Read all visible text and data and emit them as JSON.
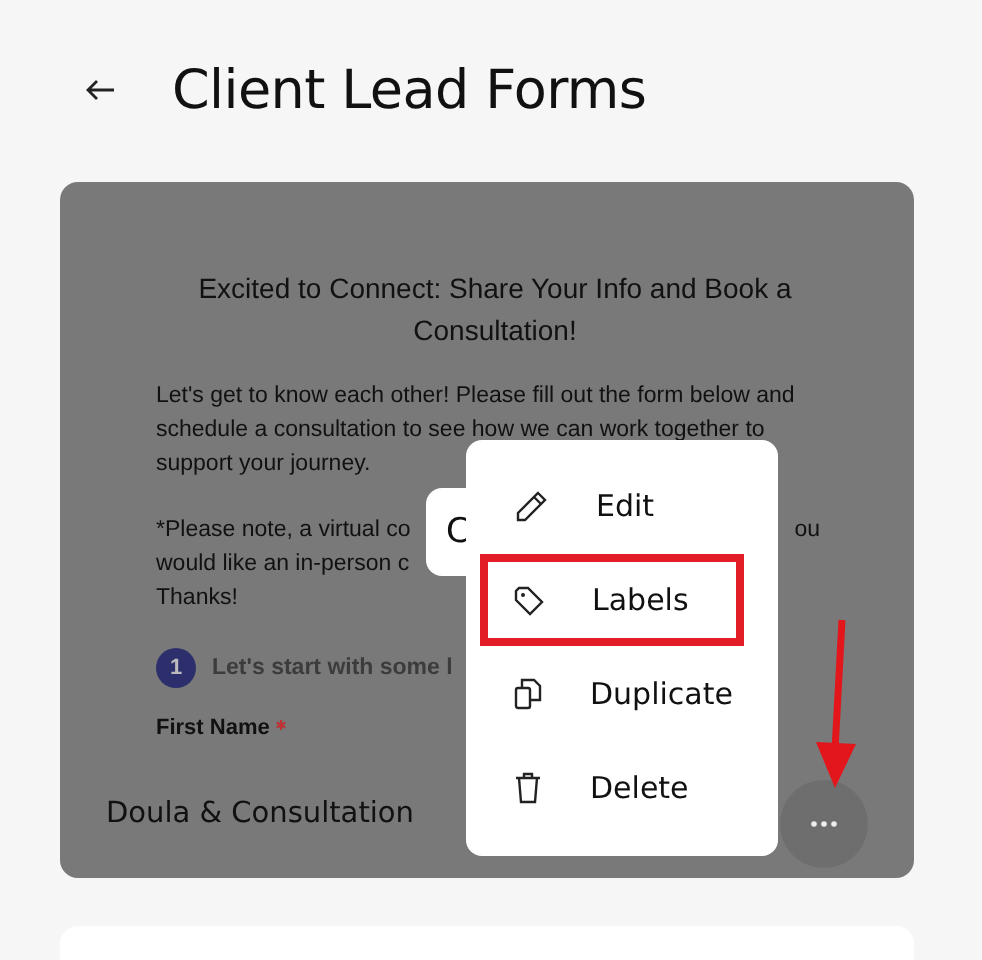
{
  "header": {
    "title": "Client Lead Forms"
  },
  "form_card": {
    "preview": {
      "heading": "Excited to Connect: Share Your Info and Book a Consultation!",
      "intro": "Let's get to know each other! Please fill out the form below and schedule a consultation to see how we can work together to support your journey.",
      "note_lines": [
        {
          "left": "*Please note, a virtual co",
          "right": "ou"
        },
        {
          "left": "would like an in-person c"
        },
        {
          "left": "Thanks!"
        }
      ],
      "step": {
        "number": "1",
        "label": "Let's start with some l"
      },
      "field": {
        "label": "First Name",
        "required": true
      }
    },
    "tooltip": "C",
    "name": "Doula & Consultation",
    "more_button": {
      "open": true
    }
  },
  "menu": {
    "items": [
      {
        "kind": "edit",
        "label": "Edit",
        "highlighted": false
      },
      {
        "kind": "labels",
        "label": "Labels",
        "highlighted": true
      },
      {
        "kind": "duplicate",
        "label": "Duplicate",
        "highlighted": false
      },
      {
        "kind": "delete",
        "label": "Delete",
        "highlighted": false
      }
    ]
  }
}
